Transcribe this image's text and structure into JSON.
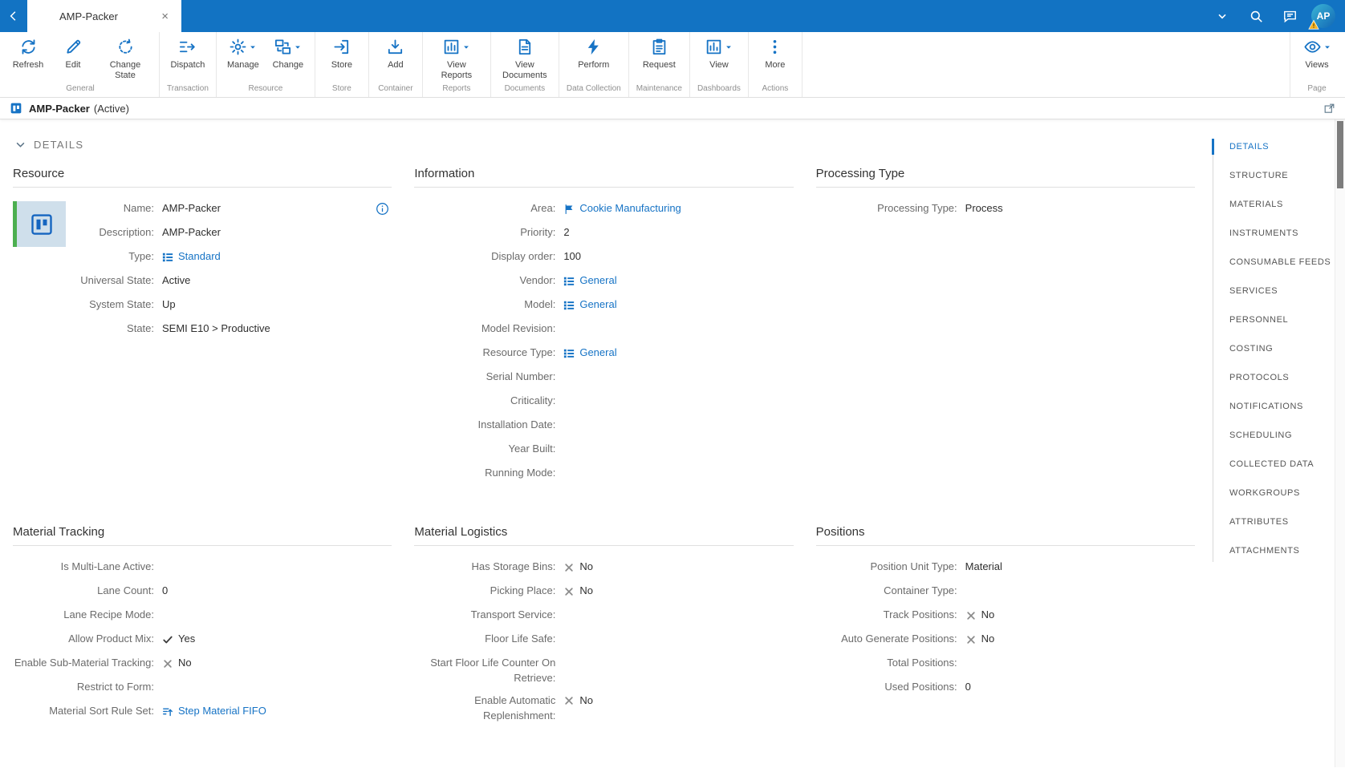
{
  "colors": {
    "topbar": "#1273c3",
    "accent": "#1673c5",
    "link": "#1673c5",
    "image_accent_green": "#4caf50",
    "warning_badge": "#f5b324"
  },
  "topbar": {
    "tab_title": "AMP-Packer",
    "avatar_initials": "AP"
  },
  "ribbon": {
    "groups": [
      {
        "label": "General",
        "buttons": [
          {
            "label": "Refresh",
            "icon": "refresh"
          },
          {
            "label": "Edit",
            "icon": "edit"
          },
          {
            "label": "Change State",
            "icon": "change-state"
          }
        ]
      },
      {
        "label": "Transaction",
        "buttons": [
          {
            "label": "Dispatch",
            "icon": "dispatch"
          }
        ]
      },
      {
        "label": "Resource",
        "buttons": [
          {
            "label": "Manage",
            "icon": "gear",
            "dropdown": true
          },
          {
            "label": "Change",
            "icon": "change",
            "dropdown": true
          }
        ]
      },
      {
        "label": "Store",
        "buttons": [
          {
            "label": "Store",
            "icon": "store"
          }
        ]
      },
      {
        "label": "Container",
        "buttons": [
          {
            "label": "Add",
            "icon": "add"
          }
        ]
      },
      {
        "label": "Reports",
        "buttons": [
          {
            "label": "View Reports",
            "icon": "report",
            "dropdown": true
          }
        ]
      },
      {
        "label": "Documents",
        "buttons": [
          {
            "label": "View Documents",
            "icon": "document"
          }
        ]
      },
      {
        "label": "Data Collection",
        "buttons": [
          {
            "label": "Perform",
            "icon": "bolt"
          }
        ]
      },
      {
        "label": "Maintenance",
        "buttons": [
          {
            "label": "Request",
            "icon": "clipboard"
          }
        ]
      },
      {
        "label": "Dashboards",
        "buttons": [
          {
            "label": "View",
            "icon": "dashboard",
            "dropdown": true
          }
        ]
      },
      {
        "label": "Actions",
        "buttons": [
          {
            "label": "More",
            "icon": "more"
          }
        ]
      }
    ],
    "page_group": {
      "label": "Page",
      "buttons": [
        {
          "label": "Views",
          "icon": "eye",
          "dropdown": true
        }
      ]
    }
  },
  "entity_header": {
    "name": "AMP-Packer",
    "state": "(Active)"
  },
  "details": {
    "section_label": "DETAILS"
  },
  "panels_top": [
    {
      "title": "Resource",
      "has_image": true,
      "info_icon": true,
      "fields": [
        {
          "label": "Name:",
          "type": "text",
          "value": "AMP-Packer"
        },
        {
          "label": "Description:",
          "type": "text",
          "value": "AMP-Packer"
        },
        {
          "label": "Type:",
          "type": "link",
          "icon": "list",
          "value": "Standard"
        },
        {
          "label": "Universal State:",
          "type": "text",
          "value": "Active"
        },
        {
          "label": "System State:",
          "type": "text",
          "value": "Up"
        },
        {
          "label": "State:",
          "type": "text",
          "value": "SEMI E10 > Productive"
        }
      ]
    },
    {
      "title": "Information",
      "fields": [
        {
          "label": "Area:",
          "type": "link",
          "icon": "flag",
          "value": "Cookie Manufacturing"
        },
        {
          "label": "Priority:",
          "type": "text",
          "value": "2"
        },
        {
          "label": "Display order:",
          "type": "text",
          "value": "100"
        },
        {
          "label": "Vendor:",
          "type": "link",
          "icon": "list",
          "value": "General"
        },
        {
          "label": "Model:",
          "type": "link",
          "icon": "list",
          "value": "General"
        },
        {
          "label": "Model Revision:",
          "type": "text",
          "value": ""
        },
        {
          "label": "Resource Type:",
          "type": "link",
          "icon": "list",
          "value": "General"
        },
        {
          "label": "Serial Number:",
          "type": "text",
          "value": ""
        },
        {
          "label": "Criticality:",
          "type": "text",
          "value": ""
        },
        {
          "label": "Installation Date:",
          "type": "text",
          "value": ""
        },
        {
          "label": "Year Built:",
          "type": "text",
          "value": ""
        },
        {
          "label": "Running Mode:",
          "type": "text",
          "value": ""
        }
      ]
    },
    {
      "title": "Processing Type",
      "fields": [
        {
          "label": "Processing Type:",
          "type": "text",
          "value": "Process"
        }
      ]
    }
  ],
  "panels_bottom": [
    {
      "title": "Material Tracking",
      "fields": [
        {
          "label": "Is Multi-Lane Active:",
          "type": "text",
          "value": ""
        },
        {
          "label": "Lane Count:",
          "type": "text",
          "value": "0"
        },
        {
          "label": "Lane Recipe Mode:",
          "type": "text",
          "value": ""
        },
        {
          "label": "Allow Product Mix:",
          "type": "bool",
          "value": "Yes"
        },
        {
          "label": "Enable Sub-Material Tracking:",
          "type": "bool",
          "value": "No"
        },
        {
          "label": "Restrict to Form:",
          "type": "text",
          "value": ""
        },
        {
          "label": "Material Sort Rule Set:",
          "type": "link",
          "icon": "sort",
          "value": "Step Material FIFO"
        }
      ]
    },
    {
      "title": "Material Logistics",
      "fields": [
        {
          "label": "Has Storage Bins:",
          "type": "bool",
          "value": "No"
        },
        {
          "label": "Picking Place:",
          "type": "bool",
          "value": "No"
        },
        {
          "label": "Transport Service:",
          "type": "text",
          "value": ""
        },
        {
          "label": "Floor Life Safe:",
          "type": "text",
          "value": ""
        },
        {
          "label": "Start Floor Life Counter On Retrieve:",
          "type": "text",
          "value": ""
        },
        {
          "label": "Enable Automatic Replenishment:",
          "type": "bool",
          "value": "No"
        }
      ]
    },
    {
      "title": "Positions",
      "fields": [
        {
          "label": "Position Unit Type:",
          "type": "text",
          "value": "Material"
        },
        {
          "label": "Container Type:",
          "type": "text",
          "value": ""
        },
        {
          "label": "Track Positions:",
          "type": "bool",
          "value": "No"
        },
        {
          "label": "Auto Generate Positions:",
          "type": "bool",
          "value": "No"
        },
        {
          "label": "Total Positions:",
          "type": "text",
          "value": ""
        },
        {
          "label": "Used Positions:",
          "type": "text",
          "value": "0"
        }
      ]
    }
  ],
  "sidebar": {
    "items": [
      {
        "label": "DETAILS",
        "active": true
      },
      {
        "label": "STRUCTURE"
      },
      {
        "label": "MATERIALS"
      },
      {
        "label": "INSTRUMENTS"
      },
      {
        "label": "CONSUMABLE FEEDS"
      },
      {
        "label": "SERVICES"
      },
      {
        "label": "PERSONNEL"
      },
      {
        "label": "COSTING"
      },
      {
        "label": "PROTOCOLS"
      },
      {
        "label": "NOTIFICATIONS"
      },
      {
        "label": "SCHEDULING"
      },
      {
        "label": "COLLECTED DATA"
      },
      {
        "label": "WORKGROUPS"
      },
      {
        "label": "ATTRIBUTES"
      },
      {
        "label": "ATTACHMENTS"
      }
    ]
  }
}
